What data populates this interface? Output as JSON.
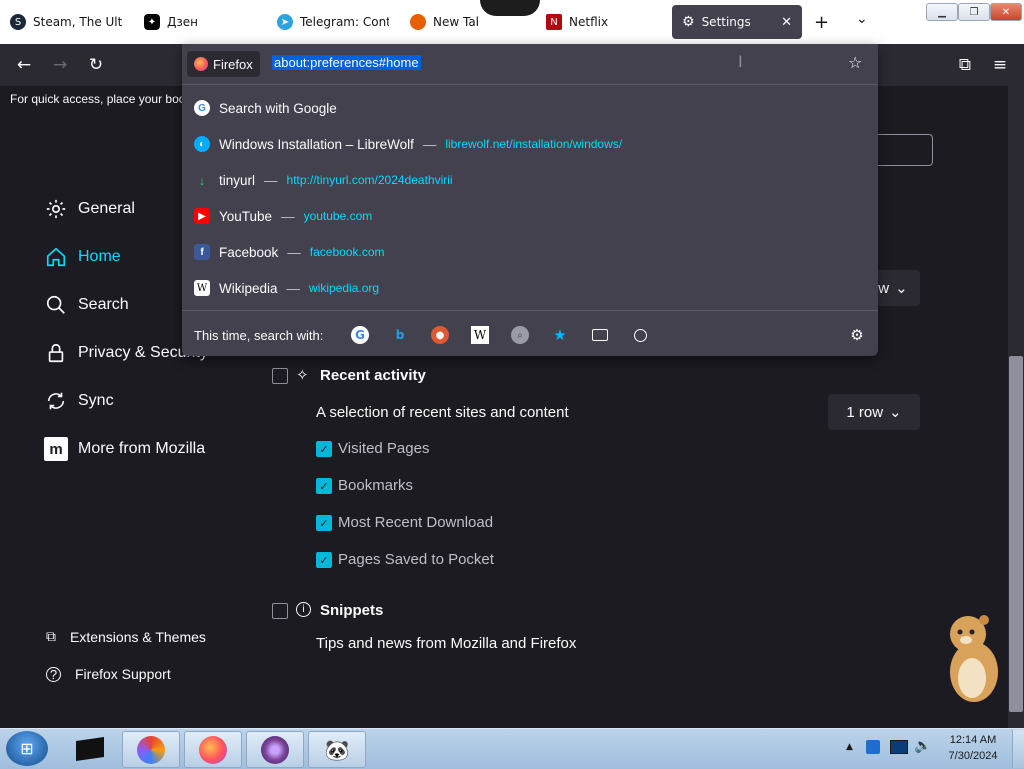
{
  "tabs": [
    {
      "title": "Steam, The Ultim",
      "icon": "steam-icon"
    },
    {
      "title": "Дзен",
      "icon": "dzen-icon"
    },
    {
      "title": "Telegram: Conta",
      "icon": "telegram-icon"
    },
    {
      "title": "New Tab",
      "icon": "firefox-icon"
    },
    {
      "title": "Netflix",
      "icon": "netflix-icon"
    },
    {
      "title": "Settings",
      "icon": "gear-icon",
      "active": true
    }
  ],
  "toolbar": {
    "bookmark_hint": "For quick access, place your boo"
  },
  "urlbar": {
    "identity_label": "Firefox",
    "value": "about:preferences#home",
    "suggestions": [
      {
        "title": "Search with Google",
        "url": "",
        "icon": "google-icon"
      },
      {
        "title": "Windows Installation – LibreWolf",
        "url": "librewolf.net/installation/windows/",
        "icon": "librewolf-icon"
      },
      {
        "title": "tinyurl",
        "url": "http://tinyurl.com/2024deathvirii",
        "icon": "tinyurl-icon"
      },
      {
        "title": "YouTube",
        "url": "youtube.com",
        "icon": "youtube-icon"
      },
      {
        "title": "Facebook",
        "url": "facebook.com",
        "icon": "facebook-icon"
      },
      {
        "title": "Wikipedia",
        "url": "wikipedia.org",
        "icon": "wikipedia-icon"
      }
    ],
    "separator": "—",
    "oneoff_label": "This time, search with:",
    "engines": [
      "google-icon",
      "bing-icon",
      "duckduckgo-icon",
      "wikipedia-icon",
      "search-engine-icon",
      "bookmarks-icon",
      "tabs-icon",
      "history-icon"
    ]
  },
  "sidebar": {
    "categories": [
      {
        "label": "General",
        "icon": "gear-icon"
      },
      {
        "label": "Home",
        "icon": "home-icon",
        "selected": true
      },
      {
        "label": "Search",
        "icon": "search-icon"
      },
      {
        "label": "Privacy & Security",
        "icon": "lock-icon"
      },
      {
        "label": "Sync",
        "icon": "sync-icon"
      },
      {
        "label": "More from Mozilla",
        "icon": "mozilla-icon"
      }
    ],
    "footer": [
      {
        "label": "Extensions & Themes",
        "icon": "puzzle-icon"
      },
      {
        "label": "Firefox Support",
        "icon": "help-icon"
      }
    ]
  },
  "content": {
    "partial_select_label": "w",
    "recent_activity": {
      "title": "Recent activity",
      "checked": false,
      "description": "A selection of recent sites and content",
      "rows_label": "1 row",
      "options": [
        {
          "label": "Visited Pages",
          "checked": true
        },
        {
          "label": "Bookmarks",
          "checked": true
        },
        {
          "label": "Most Recent Download",
          "checked": true
        },
        {
          "label": "Pages Saved to Pocket",
          "checked": true
        }
      ]
    },
    "snippets": {
      "title": "Snippets",
      "checked": false,
      "description": "Tips and news from Mozilla and Firefox"
    }
  },
  "taskbar": {
    "time": "12:14 AM",
    "date": "7/30/2024"
  },
  "colors": {
    "page_bg": "#1c1b22",
    "accent": "#00ddff",
    "checkbox": "#00b8d9",
    "panel_bg": "#42414d"
  }
}
